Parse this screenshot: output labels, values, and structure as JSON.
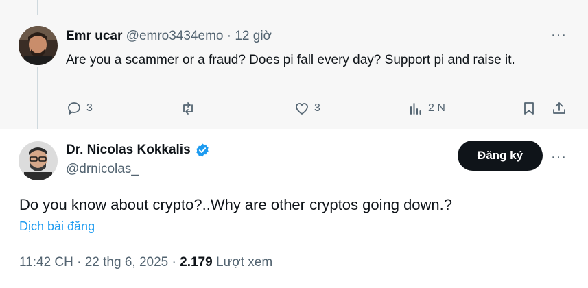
{
  "reply": {
    "author_name": "Emr ucar",
    "handle": "@emro3434emo",
    "separator": "·",
    "time": "12 giờ",
    "more": "···",
    "text": "Are you a scammer or a fraud? Does pi fall every day? Support pi and raise it.",
    "actions": {
      "replies": "3",
      "reposts": "",
      "likes": "3",
      "views": "2 N"
    }
  },
  "main_post": {
    "author_name": "Dr. Nicolas Kokkalis",
    "handle": "@drnicolas_",
    "follow_label": "Đăng ký",
    "more": "···",
    "text": "Do you know about crypto?..Why are other cryptos going down.?",
    "translate_label": "Dịch bài đăng",
    "timestamp": "11:42 CH · 22 thg 6, 2025",
    "separator": "·",
    "view_count": "2.179",
    "view_label": "Lượt xem"
  },
  "icons": {
    "reply": "reply-icon",
    "repost": "repost-icon",
    "like": "heart-icon",
    "views": "analytics-icon",
    "bookmark": "bookmark-icon",
    "share": "share-icon",
    "verified": "verified-badge-icon"
  },
  "colors": {
    "accent": "#1d9bf0",
    "text": "#0f1419",
    "muted": "#536471",
    "button_bg": "#0f1419",
    "reply_bg": "#f7f7f7"
  }
}
